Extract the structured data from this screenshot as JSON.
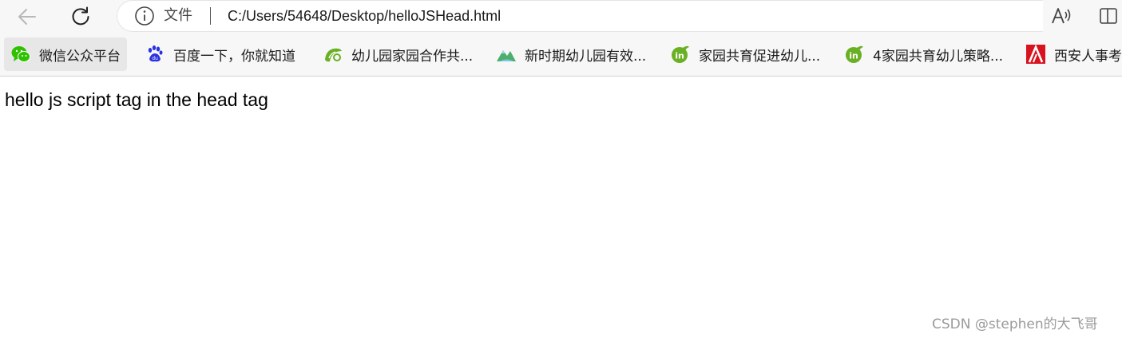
{
  "browser": {
    "nav": {
      "back_icon": "arrow-left-icon",
      "refresh_icon": "refresh-icon"
    },
    "address_bar": {
      "info_icon": "info-circle-icon",
      "scheme_label": "文件",
      "url": "C:/Users/54648/Desktop/helloJSHead.html"
    },
    "toolbar_right": {
      "read_aloud_icon": "read-aloud-icon",
      "split_screen_icon": "split-screen-icon"
    },
    "bookmarks": [
      {
        "label": "微信公众平台",
        "icon": "wechat-icon"
      },
      {
        "label": "百度一下，你就知道",
        "icon": "baidu-paw-icon"
      },
      {
        "label": "幼儿园家园合作共...",
        "icon": "leaf-swirl-icon"
      },
      {
        "label": "新时期幼儿园有效...",
        "icon": "mountain-icon"
      },
      {
        "label": "家园共育促进幼儿...",
        "icon": "in-leaf-icon"
      },
      {
        "label": "4家园共育幼儿策略...",
        "icon": "in-leaf-icon"
      },
      {
        "label": "西安人事考",
        "icon": "red-a-logo-icon"
      }
    ]
  },
  "page": {
    "body_text": "hello js script tag in the head tag"
  },
  "watermark": {
    "text": "CSDN @stephen的大飞哥"
  },
  "colors": {
    "toolbar_bg": "#f7f7f7",
    "wechat_green": "#2dc100",
    "baidu_blue": "#2932e1",
    "leaf_green": "#6ab023",
    "red_logo": "#d9121f"
  }
}
